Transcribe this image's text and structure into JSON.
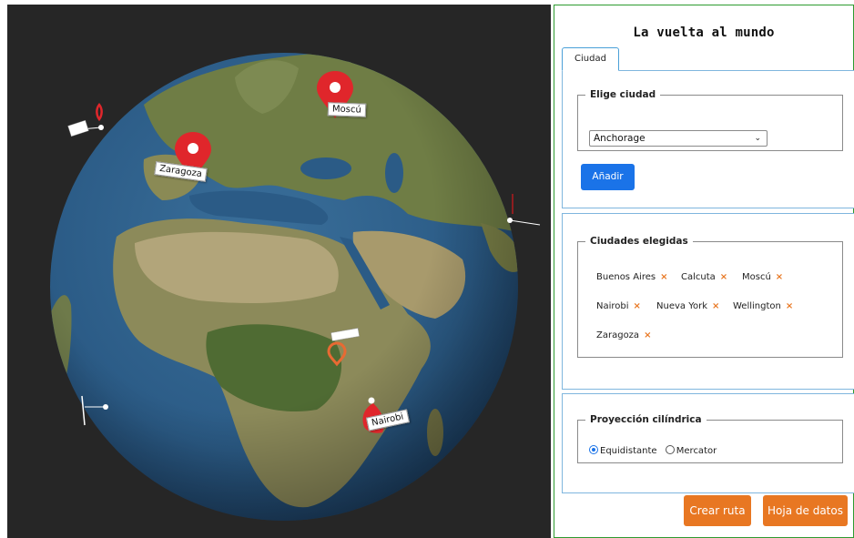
{
  "globe": {
    "pins": [
      {
        "name": "Moscú",
        "size": "large"
      },
      {
        "name": "Zaragoza",
        "size": "large"
      },
      {
        "name": "Nairobi",
        "size": "large"
      },
      {
        "name": "",
        "size": "small"
      },
      {
        "name": "",
        "size": "small"
      }
    ],
    "colors": {
      "background": "#262626",
      "ocean": "#2a5a85",
      "land": "#7d8a4a",
      "pin": "#e0262b"
    }
  },
  "panel": {
    "title": "La vuelta al mundo",
    "tab": "Ciudad",
    "city_picker": {
      "legend": "Elige ciudad",
      "selected": "Anchorage",
      "add_label": "Añadir"
    },
    "chosen": {
      "legend": "Ciudades elegidas",
      "cities": [
        "Buenos Aires",
        "Calcuta",
        "Moscú",
        "Nairobi",
        "Nueva York",
        "Wellington",
        "Zaragoza"
      ],
      "remove_icon": "×"
    },
    "projection": {
      "legend": "Proyección cilíndrica",
      "options": [
        "Equidistante",
        "Mercator"
      ],
      "selected": "Equidistante"
    },
    "create_route_label": "Crear ruta",
    "datasheet_label": "Hoja de datos",
    "colors": {
      "accent_blue": "#1a73e8",
      "accent_orange": "#e87722",
      "panel_border": "#2e9b30"
    }
  }
}
